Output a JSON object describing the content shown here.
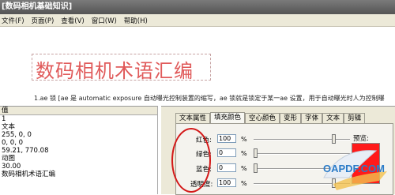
{
  "window": {
    "title": "[数码相机基础知识]"
  },
  "menu": {
    "items": [
      "文件(F)",
      "页面(P)",
      "查看(V)",
      "窗口(W)",
      "帮助(H)"
    ]
  },
  "document": {
    "heading": "数码相机术语汇编",
    "paragraph": "1.ae 锁 [ae 是 automatic exposure 自动曝光控制装置的缩写，ae 锁就是锁定于某一ae 设置，用于自动曝光时人为控制曝"
  },
  "properties": {
    "header": "值",
    "values": [
      "1",
      "文本",
      "255, 0, 0",
      "0, 0, 0",
      "59.21, 770.08",
      "动图",
      "30.00",
      "数码相机术语汇编"
    ]
  },
  "tabs": [
    "文本属性",
    "填充颜色",
    "空心颜色",
    "变形",
    "字体",
    "文本",
    "剪辑"
  ],
  "fill": {
    "red_label": "红色:",
    "red_value": "100",
    "red_level": 0.85,
    "green_label": "绿色:",
    "green_value": "0",
    "green_level": 0,
    "blue_label": "蓝色:",
    "blue_value": "0",
    "blue_level": 0,
    "alpha_label": "透明度:",
    "alpha_value": "100",
    "alpha_level": 0.85,
    "unit": "%",
    "preview_label": "预览:",
    "preview_color": "#ff1a1a"
  },
  "watermark": {
    "text": "OAPDF.COM",
    "accent": "#2a7bc8"
  }
}
